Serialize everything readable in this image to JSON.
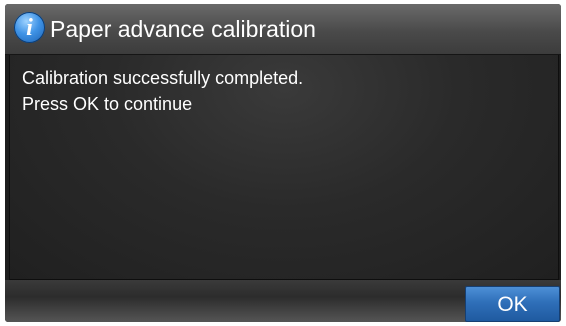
{
  "dialog": {
    "title": "Paper advance calibration",
    "icon": "info-icon",
    "icon_glyph": "i",
    "message_lines": [
      "Calibration successfully completed.",
      "Press OK to continue"
    ],
    "ok_label": "OK"
  },
  "colors": {
    "accent_button": "#2f6fb9",
    "info_icon": "#3f93e6",
    "background": "#1d1d1d",
    "text": "#ffffff"
  }
}
